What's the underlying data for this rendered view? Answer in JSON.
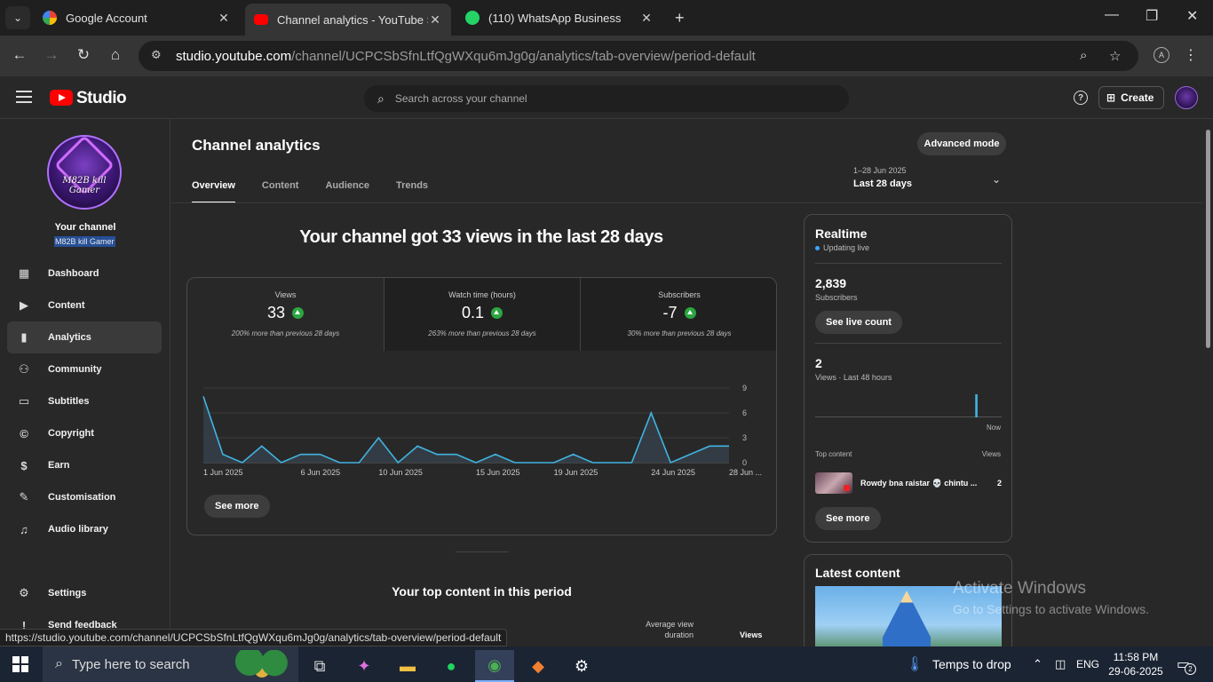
{
  "browser": {
    "tabs": [
      {
        "label": "Google Account",
        "close": "✕"
      },
      {
        "label": "Channel analytics - YouTube Studio",
        "close": "✕"
      },
      {
        "label": "(110) WhatsApp Business",
        "close": "✕"
      }
    ],
    "new_tab": "+",
    "url_host": "studio.youtube.com",
    "url_path": "/channel/UCPCSbSfnLtfQgWXqu6mJg0g/analytics/tab-overview/period-default",
    "profile_initial": "A",
    "status_url": "https://studio.youtube.com/channel/UCPCSbSfnLtfQgWXqu6mJg0g/analytics/tab-overview/period-default"
  },
  "header": {
    "logo_text": "Studio",
    "search_placeholder": "Search across your channel",
    "create_label": "Create"
  },
  "sidebar": {
    "your_channel": "Your channel",
    "channel_name": "M82B kill Gamer",
    "avatar_text": "M82B kill Gamer",
    "items": [
      {
        "label": "Dashboard",
        "icon": "dashboard-icon"
      },
      {
        "label": "Content",
        "icon": "content-icon"
      },
      {
        "label": "Analytics",
        "icon": "analytics-icon"
      },
      {
        "label": "Community",
        "icon": "community-icon"
      },
      {
        "label": "Subtitles",
        "icon": "subtitles-icon"
      },
      {
        "label": "Copyright",
        "icon": "copyright-icon"
      },
      {
        "label": "Earn",
        "icon": "earn-icon"
      },
      {
        "label": "Customisation",
        "icon": "customisation-icon"
      },
      {
        "label": "Audio library",
        "icon": "audio-library-icon"
      }
    ],
    "settings_label": "Settings",
    "feedback_label": "Send feedback"
  },
  "main": {
    "title": "Channel analytics",
    "advanced_mode": "Advanced mode",
    "tabs": [
      "Overview",
      "Content",
      "Audience",
      "Trends"
    ],
    "period_range": "1–28 Jun 2025",
    "period_label": "Last 28 days",
    "headline": "Your channel got 33 views in the last 28 days",
    "metrics": [
      {
        "label": "Views",
        "value": "33",
        "sub": "200% more than previous 28 days"
      },
      {
        "label": "Watch time (hours)",
        "value": "0.1",
        "sub": "263% more than previous 28 days"
      },
      {
        "label": "Subscribers",
        "value": "-7",
        "sub": "30% more than previous 28 days"
      }
    ],
    "see_more": "See more",
    "top_content_title": "Your top content in this period",
    "col_avg_view": "Average view duration",
    "col_views": "Views"
  },
  "realtime": {
    "title": "Realtime",
    "live": "Updating live",
    "subs_value": "2,839",
    "subs_label": "Subscribers",
    "see_live": "See live count",
    "views_value": "2",
    "views_label": "Views · Last 48 hours",
    "now_label": "Now",
    "top_content": "Top content",
    "views_col": "Views",
    "item_title": "Rowdy bna raistar 💀 chintu ...",
    "item_views": "2",
    "see_more": "See more"
  },
  "latest": {
    "title": "Latest content"
  },
  "watermark": {
    "line1": "Activate Windows",
    "line2": "Go to Settings to activate Windows."
  },
  "taskbar": {
    "search_text": "Type here to search",
    "weather": "Temps to drop",
    "lang": "ENG",
    "time": "11:58 PM",
    "date": "29-06-2025",
    "notif_count": "2"
  },
  "chart_data": {
    "type": "area",
    "x_labels": [
      "1 Jun 2025",
      "6 Jun 2025",
      "10 Jun 2025",
      "15 Jun 2025",
      "19 Jun 2025",
      "24 Jun 2025",
      "28 Jun ..."
    ],
    "x_label_days": [
      1,
      6,
      10,
      15,
      19,
      24,
      28
    ],
    "x": [
      1,
      2,
      3,
      4,
      5,
      6,
      7,
      8,
      9,
      10,
      11,
      12,
      13,
      14,
      15,
      16,
      17,
      18,
      19,
      20,
      21,
      22,
      23,
      24,
      25,
      26,
      27,
      28
    ],
    "values": [
      8,
      1,
      0,
      2,
      0,
      1,
      1,
      0,
      0,
      3,
      0,
      2,
      1,
      1,
      0,
      1,
      0,
      0,
      0,
      1,
      0,
      0,
      0,
      6,
      0,
      1,
      2,
      2
    ],
    "yticks": [
      0,
      3,
      6,
      9
    ],
    "ylim": [
      0,
      9
    ],
    "grid": true,
    "colors": {
      "line": "#41b4e0",
      "fill": "#35404a"
    },
    "realtime_bars": [
      0,
      0,
      0,
      0,
      0,
      0,
      0,
      0,
      0,
      0,
      0,
      0,
      0,
      0,
      0,
      0,
      0,
      0,
      0,
      0,
      0,
      0,
      0,
      0,
      0,
      0,
      0,
      0,
      0,
      0,
      0,
      0,
      0,
      0,
      0,
      0,
      0,
      0,
      0,
      0,
      0,
      2,
      0,
      0,
      0,
      0,
      0,
      0
    ]
  }
}
